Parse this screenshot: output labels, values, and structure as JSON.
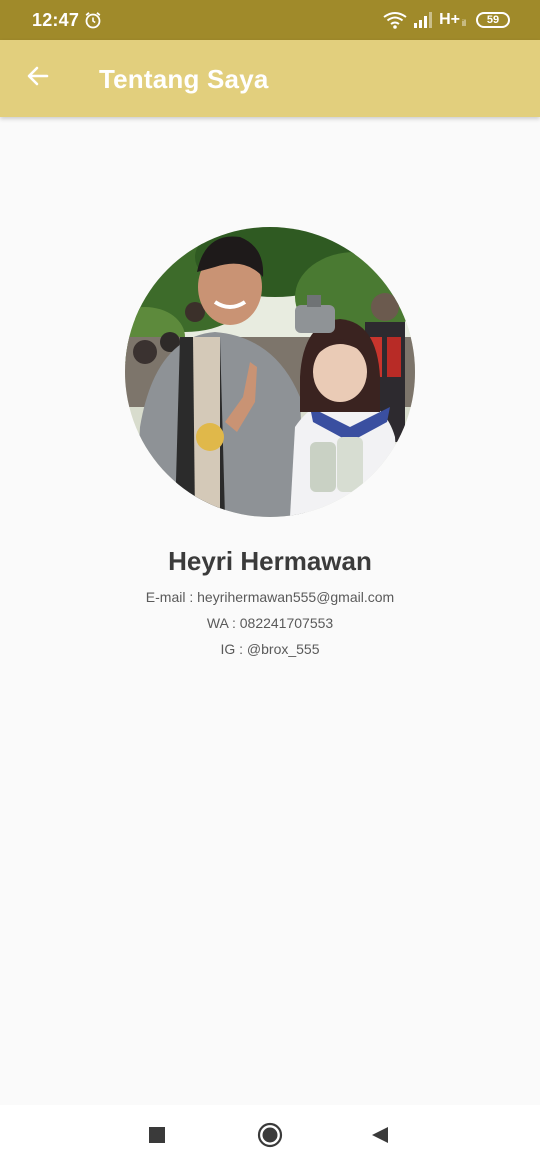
{
  "status_bar": {
    "time": "12:47",
    "network_type": "H+",
    "network_sub": "il",
    "battery_level": "59",
    "icons": [
      "alarm-icon",
      "wifi-icon",
      "signal-icon",
      "battery-icon"
    ]
  },
  "app_bar": {
    "title": "Tentang Saya",
    "back_icon": "back-arrow-icon",
    "background_color": "#e2cf7d"
  },
  "profile": {
    "name": "Heyri Hermawan",
    "email": "E-mail : heyrihermawan555@gmail.com",
    "whatsapp": "WA : 082241707553",
    "instagram": "IG : @brox_555"
  },
  "nav_bar": {
    "icons": [
      "recent-apps-icon",
      "home-icon",
      "back-icon"
    ]
  },
  "colors": {
    "status_bar": "#a08a2a",
    "app_bar": "#e2cf7d",
    "background": "#fafafa",
    "text_primary": "#3b3b3b",
    "text_secondary": "#5a5a5a"
  }
}
